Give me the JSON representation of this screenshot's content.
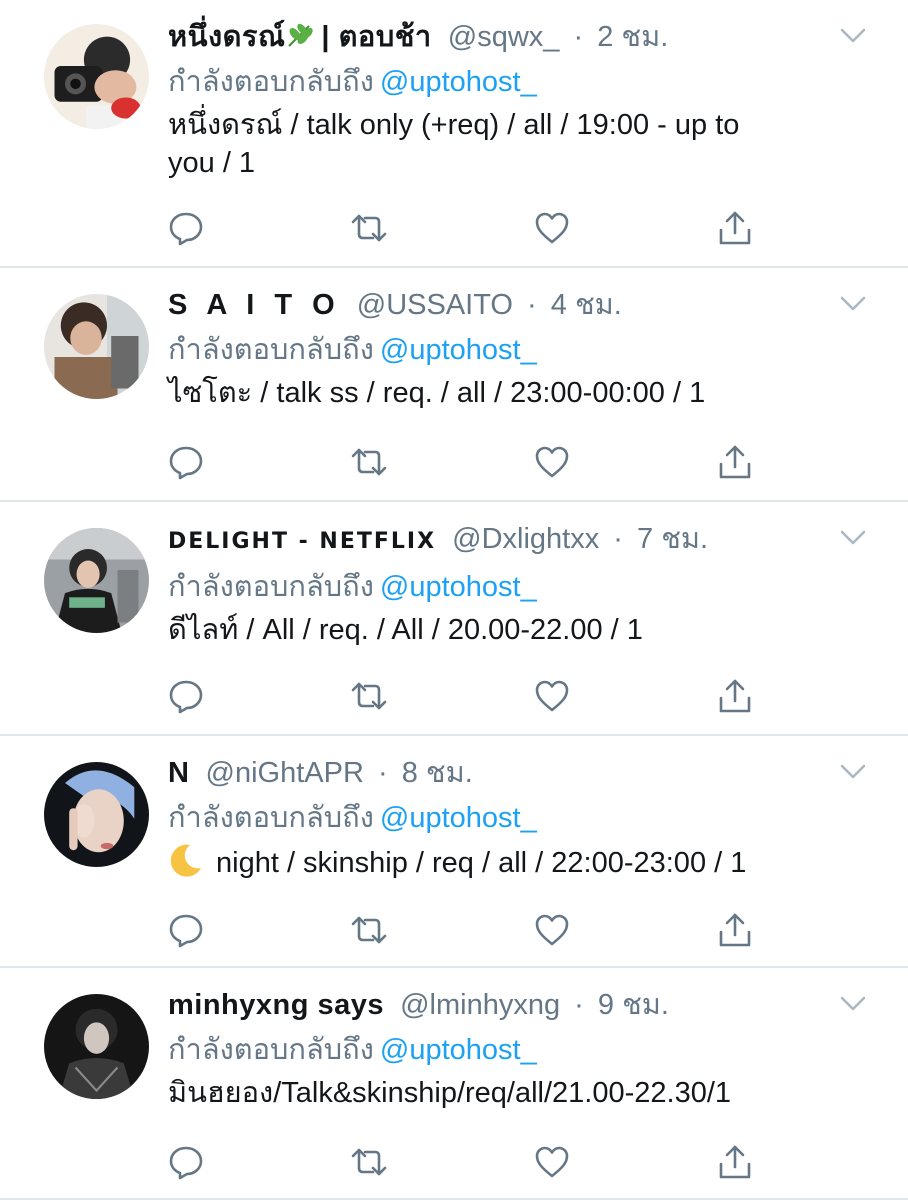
{
  "colors": {
    "text": "#14171a",
    "muted": "#657786",
    "link": "#1da1f2",
    "divider": "#e1e8ed"
  },
  "icons": {
    "caret": "chevron-down-icon",
    "reply": "reply-icon",
    "retweet": "retweet-icon",
    "like": "heart-icon",
    "share": "share-icon"
  },
  "tweets": [
    {
      "display_name": "หนึ่งดรณ์",
      "display_name_suffix": "| ตอบช้า",
      "handle": "@sqwx_",
      "separator": "·",
      "time": "2 ชม.",
      "reply_label": "กำลังตอบกลับถึง",
      "reply_mention": "@uptohost_",
      "text": "หนึ่งดรณ์ / talk only (+req) / all / 19:00 - up to\nyou / 1"
    },
    {
      "display_name": "S A I T O",
      "handle": "@USSAITO",
      "separator": "·",
      "time": "4 ชม.",
      "reply_label": "กำลังตอบกลับถึง",
      "reply_mention": "@uptohost_",
      "text": "ไซโตะ / talk ss / req. / all / 23:00-00:00 / 1"
    },
    {
      "display_name": "DELIGHT - NETFLIX",
      "handle": "@Dxlightxx",
      "separator": "·",
      "time": "7 ชม.",
      "reply_label": "กำลังตอบกลับถึง",
      "reply_mention": "@uptohost_",
      "text": "ดีไลท์ / All / req. / All / 20.00-22.00 / 1"
    },
    {
      "display_name": "N",
      "handle": "@niGhtAPR",
      "separator": "·",
      "time": "8 ชม.",
      "reply_label": "กำลังตอบกลับถึง",
      "reply_mention": "@uptohost_",
      "text": "night / skinship / req / all / 22:00-23:00 / 1"
    },
    {
      "display_name": "minhyxng says",
      "handle": "@lminhyxng",
      "separator": "·",
      "time": "9 ชม.",
      "reply_label": "กำลังตอบกลับถึง",
      "reply_mention": "@uptohost_",
      "text": "มินฮยอง/Talk&skinship/req/all/21.00-22.30/1"
    }
  ]
}
